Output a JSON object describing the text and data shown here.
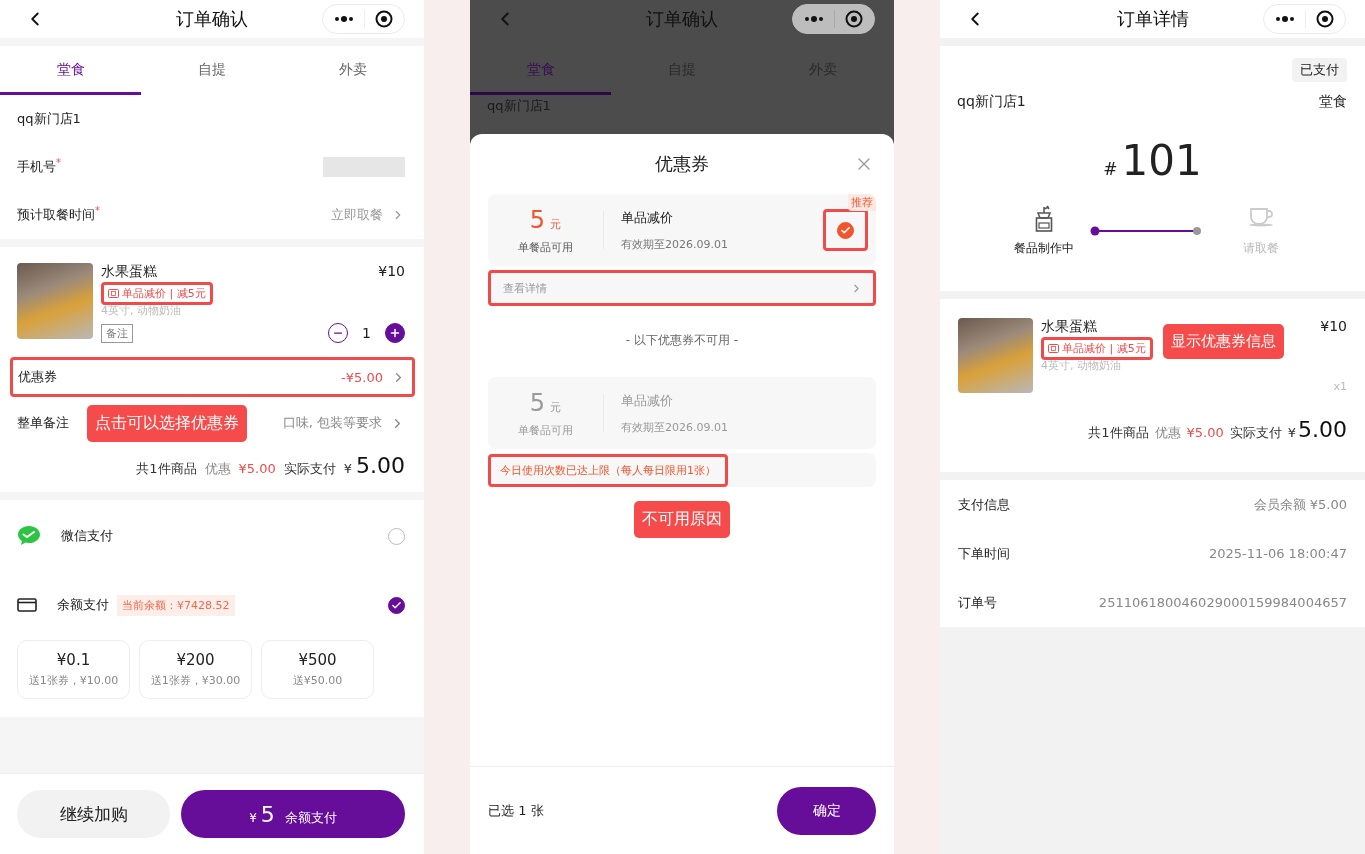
{
  "order_confirm": {
    "title": "订单确认",
    "tabs": [
      {
        "label": "堂食",
        "selected": true
      },
      {
        "label": "自提",
        "selected": false
      },
      {
        "label": "外卖",
        "selected": false
      }
    ],
    "store": "qq新门店1",
    "fields": [
      {
        "kind": "masked",
        "label": "手机号$^{*}$"
      },
      {
        "kind": "link",
        "label": "预计取餐时间$^{*}$",
        "value": "立即取餐"
      }
    ],
    "item": {
      "name": "水果蛋糕",
      "tag": {
        "text": "单品减价 | 减5元",
        "highlighted": true
      },
      "spec": "4英寸, 动物奶油",
      "note": "备注",
      "price": "¥10",
      "quantity": "1"
    },
    "coupon": {
      "label": "优惠券",
      "value": "-¥5.00",
      "highlighted": true
    },
    "remark": {
      "label": "整单备注",
      "placeholder": "口味, 包装等要求"
    },
    "callout": "点击可以选择优惠券",
    "summary": {
      "count": "共1件商品",
      "discount_label": "优惠",
      "discount": "¥5.00",
      "paid_label": "实际支付",
      "currency": "¥",
      "paid": "5.00"
    },
    "payments": [
      {
        "kind": "wechat",
        "label": "微信支付",
        "selected": false
      },
      {
        "kind": "balance",
        "label": "余额支付",
        "badge": "当前余额：¥7428.52",
        "selected": true
      }
    ],
    "recharge": [
      {
        "amount": "¥0.1",
        "bonus": "送1张券，¥10.00"
      },
      {
        "amount": "¥200",
        "bonus": "送1张券，¥30.00"
      },
      {
        "amount": "¥500",
        "bonus": "送¥50.00"
      }
    ],
    "footer": {
      "secondary": "继续加购",
      "currency": "¥",
      "amount": "5",
      "primary": "余额支付"
    }
  },
  "coupon_picker": {
    "page": {
      "title": "订单确认",
      "tabs": [
        {
          "label": "堂食",
          "selected": true
        },
        {
          "label": "自提",
          "selected": false
        },
        {
          "label": "外卖",
          "selected": false
        }
      ],
      "store": "qq新门店1"
    },
    "sheet": {
      "title": "优惠券",
      "available": [
        {
          "amount": "5",
          "unit": "元",
          "scope": "单餐品可用",
          "name": "单品减价",
          "validity": "有效期至2026.09.01",
          "badge": "推荐",
          "selected": true,
          "check_highlighted": true,
          "details": {
            "text": "查看详情",
            "highlighted": true
          }
        }
      ],
      "unavailable_heading": "- 以下优惠券不可用 -",
      "unavailable": [
        {
          "amount": "5",
          "unit": "元",
          "scope": "单餐品可用",
          "name": "单品减价",
          "validity": "有效期至2026.09.01",
          "reason": {
            "text": "今日使用次数已达上限（每人每日限用1张）",
            "highlighted": true
          }
        }
      ],
      "callout": "不可用原因",
      "selected_count": "已选 1 张",
      "confirm": "确定"
    }
  },
  "order_detail": {
    "title": "订单详情",
    "status": "已支付",
    "store": "qq新门店1",
    "order_type": "堂食",
    "number_prefix": "#",
    "number": "101",
    "progress": [
      {
        "label": "餐品制作中",
        "done": true
      },
      {
        "label": "请取餐",
        "done": false
      }
    ],
    "item": {
      "name": "水果蛋糕",
      "tag": {
        "text": "单品减价 | 减5元",
        "highlighted": true
      },
      "spec": "4英寸, 动物奶油",
      "price": "¥10",
      "quantity": "x1"
    },
    "callout": "显示优惠券信息",
    "summary": {
      "count": "共1件商品",
      "discount_label": "优惠",
      "discount": "¥5.00",
      "paid_label": "实际支付",
      "currency": "¥",
      "paid": "5.00"
    },
    "info": [
      {
        "label": "支付信息",
        "value": "会员余额 ¥5.00"
      },
      {
        "label": "下单时间",
        "value": "2025-11-06 18:00:47"
      },
      {
        "label": "订单号",
        "value": "251106180046029000159984004657"
      }
    ]
  }
}
